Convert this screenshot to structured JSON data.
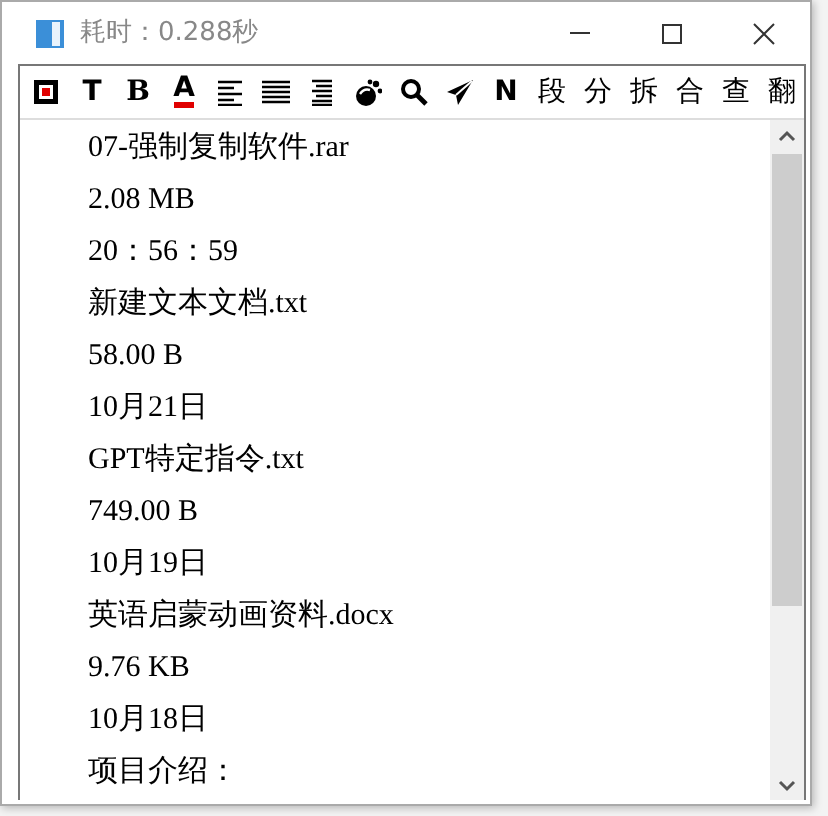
{
  "window": {
    "title": "耗时：0.288秒"
  },
  "toolbar": [
    {
      "kind": "stop"
    },
    {
      "kind": "text",
      "label": "T"
    },
    {
      "kind": "bold",
      "label": "B"
    },
    {
      "kind": "font-color",
      "label": "A"
    },
    {
      "kind": "align-left"
    },
    {
      "kind": "justify"
    },
    {
      "kind": "align-right"
    },
    {
      "kind": "paint"
    },
    {
      "kind": "search"
    },
    {
      "kind": "send"
    },
    {
      "kind": "text",
      "label": "N"
    },
    {
      "kind": "text",
      "label": "段"
    },
    {
      "kind": "text",
      "label": "分"
    },
    {
      "kind": "text",
      "label": "拆"
    },
    {
      "kind": "text",
      "label": "合"
    },
    {
      "kind": "text",
      "label": "查"
    },
    {
      "kind": "text",
      "label": "翻"
    }
  ],
  "lines": [
    "07-强制复制软件.rar",
    "2.08 MB",
    "20：56：59",
    "新建文本文档.txt",
    "58.00 B",
    "10月21日",
    "GPT特定指令.txt",
    "749.00 B",
    "10月19日",
    "英语启蒙动画资料.docx",
    "9.76 KB",
    "10月18日",
    "项目介绍："
  ]
}
